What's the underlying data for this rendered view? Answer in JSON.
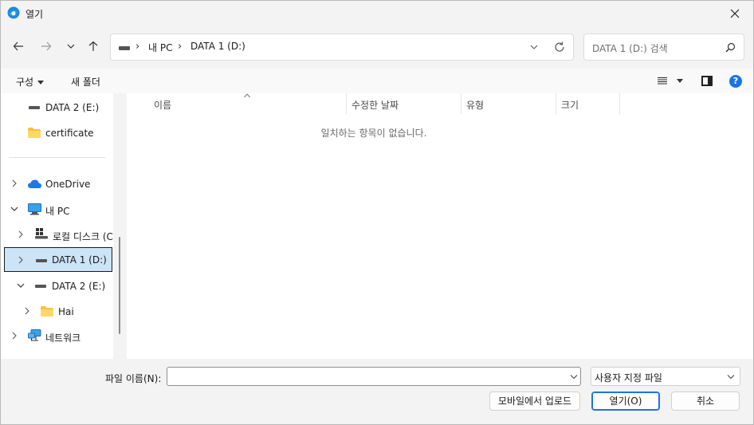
{
  "window": {
    "title": "열기"
  },
  "nav": {
    "back_icon": "arrow-left-icon",
    "forward_icon": "arrow-right-icon",
    "recent_icon": "chevron-down-icon",
    "up_icon": "arrow-up-icon"
  },
  "address": {
    "segments": [
      "내 PC",
      "DATA 1 (D:)"
    ],
    "separator": "›"
  },
  "search": {
    "placeholder": "DATA 1 (D:) 검색"
  },
  "toolbar": {
    "organize_label": "구성",
    "new_folder_label": "새 폴더"
  },
  "sidebar": {
    "items": [
      {
        "label": "DATA 2 (E:)",
        "icon": "drive-icon"
      },
      {
        "label": "certificate",
        "icon": "folder-icon"
      },
      {
        "label": "OneDrive",
        "icon": "cloud-icon"
      },
      {
        "label": "내 PC",
        "icon": "pc-icon"
      },
      {
        "label": "로컬 디스크 (C",
        "icon": "windows-drive-icon"
      },
      {
        "label": "DATA 1 (D:)",
        "icon": "drive-icon",
        "selected": true
      },
      {
        "label": "DATA 2 (E:)",
        "icon": "drive-icon"
      },
      {
        "label": "Hai",
        "icon": "folder-icon"
      },
      {
        "label": "네트워크",
        "icon": "network-icon"
      }
    ]
  },
  "columns": {
    "name": "이름",
    "modified": "수정한 날짜",
    "type": "유형",
    "size": "크기"
  },
  "content": {
    "empty_message": "일치하는 항목이 없습니다."
  },
  "footer": {
    "filename_label": "파일 이름(N):",
    "filename_value": "",
    "filter_value": "사용자 지정 파일",
    "upload_label": "모바일에서 업로드",
    "open_label": "열기(O)",
    "cancel_label": "취소"
  },
  "colors": {
    "accent": "#1a73e8",
    "selection": "#cce4f7",
    "folder": "#f5c242",
    "onedrive": "#1f7ae0"
  }
}
